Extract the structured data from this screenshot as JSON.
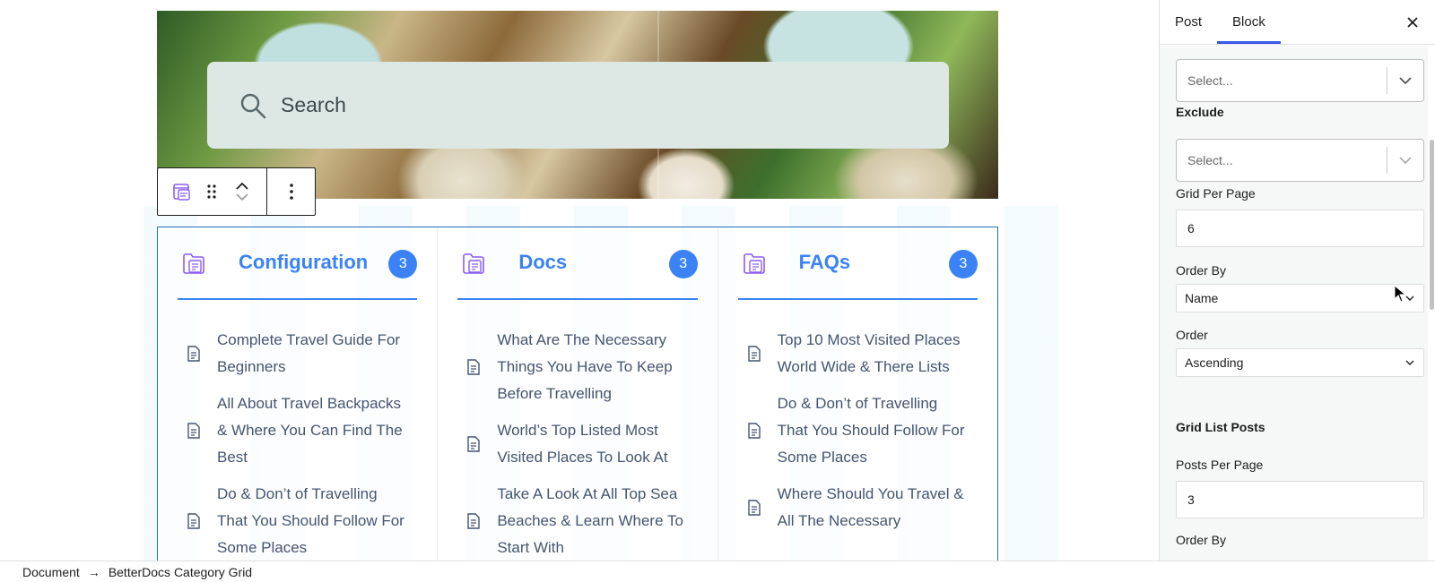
{
  "editor": {
    "search": {
      "placeholder": "Search"
    },
    "grid": {
      "categories": [
        {
          "title": "Configuration",
          "count": "3",
          "posts": [
            "Complete Travel Guide For Beginners",
            "All About Travel Backpacks & Where You Can Find The Best",
            "Do & Don’t of Travelling That You Should Follow For Some Places"
          ]
        },
        {
          "title": "Docs",
          "count": "3",
          "posts": [
            "What Are The Necessary Things You Have To Keep Before Travelling",
            "World’s Top Listed Most Visited Places To Look At",
            "Take A Look At All Top Sea Beaches & Learn Where To Start With"
          ]
        },
        {
          "title": "FAQs",
          "count": "3",
          "posts": [
            "Top 10 Most Visited Places World Wide & There Lists",
            "Do & Don’t of Travelling That You Should Follow For Some Places",
            "Where Should You Travel & All The Necessary"
          ]
        }
      ]
    },
    "toolbar": {
      "icons": [
        "betterdocs-grid-icon",
        "drag-handle-icon",
        "move-up-icon",
        "move-down-icon",
        "more-options-icon"
      ]
    }
  },
  "sidebar": {
    "tabs": [
      "Post",
      "Block"
    ],
    "active_tab": "Block",
    "include_select": {
      "placeholder": "Select..."
    },
    "exclude_label": "Exclude",
    "exclude_select": {
      "placeholder": "Select..."
    },
    "grid_per_page_label": "Grid Per Page",
    "grid_per_page_value": "6",
    "order_by_label": "Order By",
    "order_by_value": "Name",
    "order_label": "Order",
    "order_value": "Ascending",
    "grid_list_posts_heading": "Grid List Posts",
    "posts_per_page_label": "Posts Per Page",
    "posts_per_page_value": "3",
    "order_by_2_label": "Order By"
  },
  "breadcrumb": {
    "items": [
      "Document",
      "BetterDocs Category Grid"
    ]
  },
  "colors": {
    "accent": "#3b82f6",
    "wp_blue": "#3858e9",
    "post_text": "#445570"
  }
}
